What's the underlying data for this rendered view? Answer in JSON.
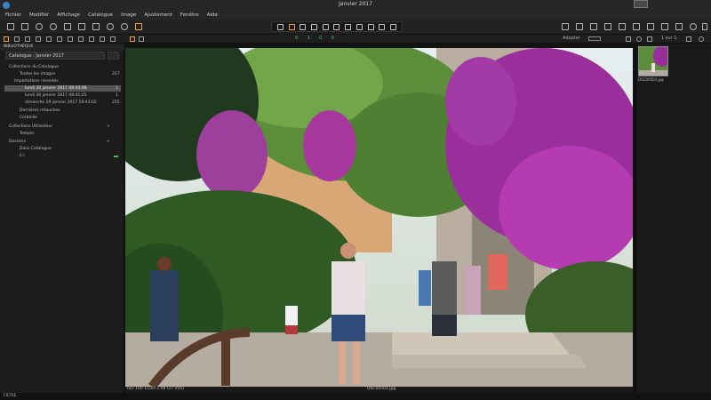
{
  "window": {
    "title": "Janvier 2017"
  },
  "menu": [
    "Fichier",
    "Modifier",
    "Affichage",
    "Catalogue",
    "Image",
    "Ajustement",
    "Fenêtre",
    "Aide"
  ],
  "subbar": {
    "counts": [
      "0",
      "1",
      "0",
      "0"
    ],
    "adapter_label": "Adapter",
    "page_counter": "1 sur 1"
  },
  "library": {
    "header": "BIBLIOTHÈQUE",
    "catalog_value": "Catalogue : Janvier 2017",
    "items": [
      {
        "label": "Collections du Catalogue",
        "count": ""
      },
      {
        "label": "Toutes les images",
        "count": "257"
      },
      {
        "label": "Importations récentes",
        "count": ""
      },
      {
        "label": "lundi 30 janvier 2017 08:43:08",
        "count": "1"
      },
      {
        "label": "lundi 30 janvier 2017 08:41:25",
        "count": "1"
      },
      {
        "label": "dimanche 29 janvier 2017 19:43:02",
        "count": "255"
      },
      {
        "label": "Dernières retouches",
        "count": ""
      },
      {
        "label": "Corbeille",
        "count": ""
      },
      {
        "label": "Collections Utilisateur",
        "count": ""
      },
      {
        "label": "Temple",
        "count": ""
      },
      {
        "label": "Dossiers",
        "count": ""
      },
      {
        "label": "Dans Catalogue",
        "count": ""
      },
      {
        "label": "E:\\",
        "count": ""
      }
    ]
  },
  "viewer": {
    "info_left": "ISO 100 1/160 s f/8 (27 mm)",
    "filename": "DSC00502.jpg"
  },
  "thumbnail": {
    "label": "DSC00502.jpg"
  },
  "status": {
    "left": "FILTRE"
  },
  "colors": {
    "accent": "#f1a33c",
    "green": "#3ac45c"
  }
}
